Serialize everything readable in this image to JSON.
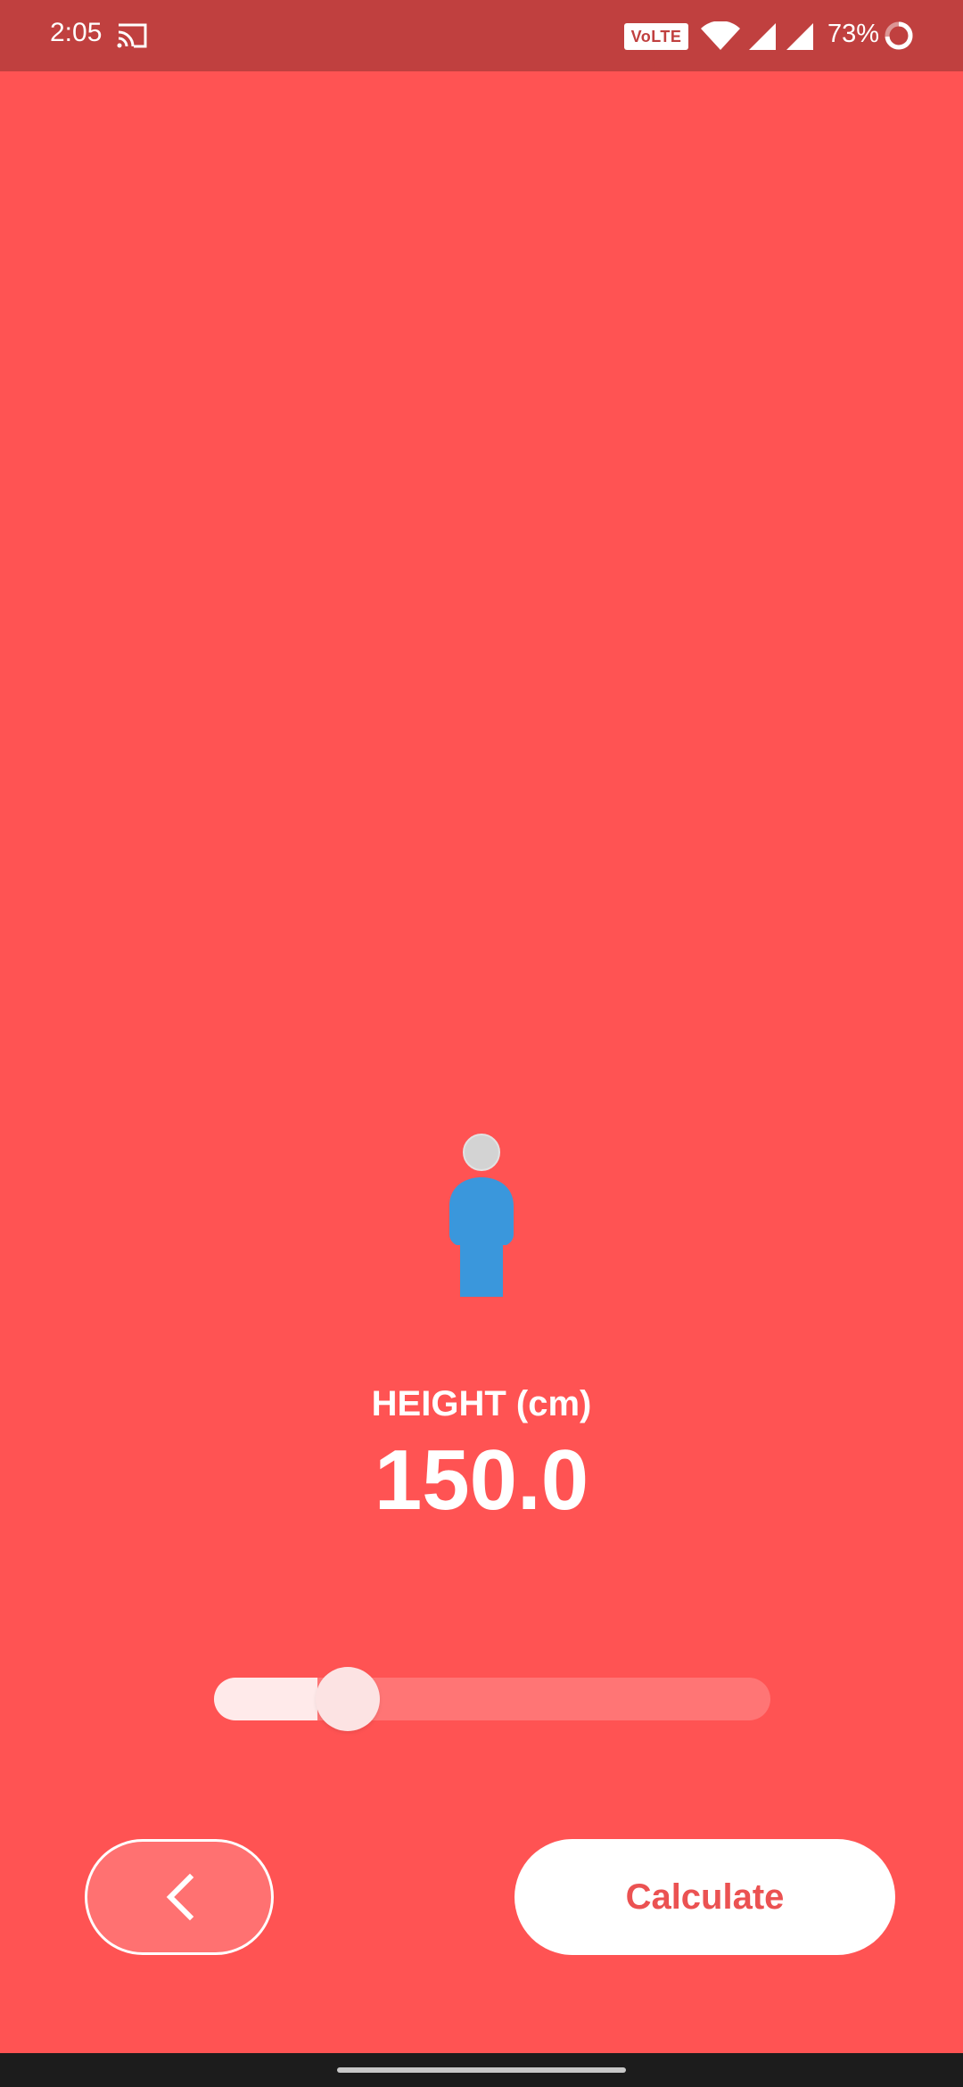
{
  "status_bar": {
    "time": "2:05",
    "volte_label": "VoLTE 1",
    "battery_percent": "73%",
    "icons": [
      "cast-icon",
      "wifi-icon",
      "signal-icon",
      "signal-icon",
      "battery-icon"
    ]
  },
  "figure": {
    "icon": "person-icon",
    "head_color": "#D3D3D3",
    "body_color": "#3A97DC"
  },
  "height": {
    "label": "HEIGHT (cm)",
    "value": "150.0"
  },
  "slider": {
    "fraction": 0.24
  },
  "buttons": {
    "back_icon": "chevron-left-icon",
    "calculate_label": "Calculate"
  },
  "colors": {
    "background": "#FF5353",
    "status_bar": "#C0403F",
    "accent_text": "#EB5252"
  }
}
